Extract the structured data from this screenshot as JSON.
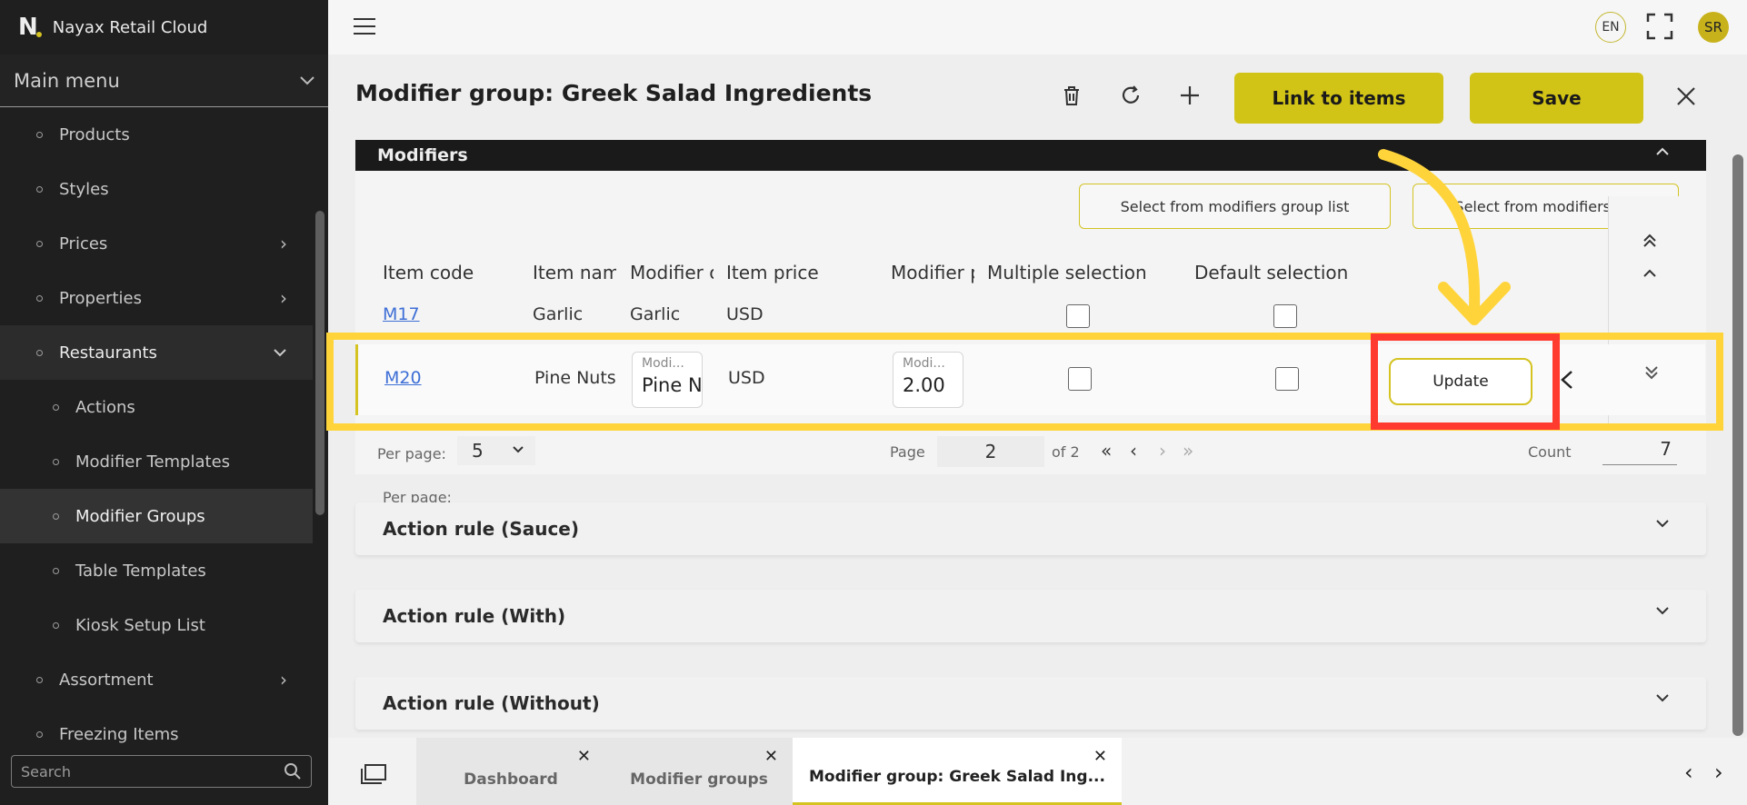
{
  "app": {
    "title": "Nayax Retail Cloud",
    "logo_letter": "N"
  },
  "sidebar": {
    "main_menu": "Main menu",
    "items": [
      {
        "label": "Products",
        "level": 1
      },
      {
        "label": "Styles",
        "level": 1
      },
      {
        "label": "Prices",
        "level": 1,
        "expandable": true
      },
      {
        "label": "Properties",
        "level": 1,
        "expandable": true
      },
      {
        "label": "Restaurants",
        "level": 1,
        "expanded": true
      },
      {
        "label": "Actions",
        "level": 2
      },
      {
        "label": "Modifier Templates",
        "level": 2
      },
      {
        "label": "Modifier Groups",
        "level": 2,
        "selected": true
      },
      {
        "label": "Table Templates",
        "level": 2
      },
      {
        "label": "Kiosk Setup List",
        "level": 2
      },
      {
        "label": "Assortment",
        "level": 1,
        "expandable": true
      },
      {
        "label": "Freezing Items",
        "level": 1
      }
    ],
    "search_placeholder": "Search"
  },
  "topbar": {
    "language": "EN",
    "user_initials": "SR"
  },
  "page": {
    "title": "Modifier group: Greek Salad Ingredients",
    "link_to_items": "Link to items",
    "save": "Save"
  },
  "modifiers": {
    "section_title": "Modifiers",
    "select_group_list": "Select from modifiers group list",
    "select_list": "Select from modifiers list",
    "columns": [
      "Item code",
      "Item nam",
      "Modifier c",
      "Item price",
      "Modifier p",
      "Multiple selection",
      "Default selection"
    ],
    "rows": [
      {
        "code": "M17",
        "name": "Garlic",
        "modifier": "Garlic",
        "price": "USD",
        "multiple": false,
        "default": false
      },
      {
        "code": "M20",
        "name": "Pine Nuts",
        "modifier_label": "Modi...",
        "modifier_value": "Pine N",
        "price": "USD",
        "mod_price_label": "Modi...",
        "mod_price_value": "2.00",
        "multiple": false,
        "default": false,
        "action": "Update"
      }
    ],
    "pager": {
      "per_page_label": "Per page:",
      "per_page": "5",
      "page_label": "Page",
      "page": "2",
      "of": "of 2",
      "count_label": "Count",
      "count": "7"
    }
  },
  "sections": [
    {
      "title": "Action rule (Sauce)"
    },
    {
      "title": "Action rule (With)"
    },
    {
      "title": "Action rule (Without)"
    }
  ],
  "tabs": [
    {
      "label": "Dashboard"
    },
    {
      "label": "Modifier groups"
    },
    {
      "label": "Modifier group: Greek Salad Ing...",
      "active": true
    }
  ],
  "colors": {
    "accent": "#d2c416",
    "highlight": "#ffd43b",
    "callout": "#ff3b30",
    "link": "#3e6fd6"
  }
}
